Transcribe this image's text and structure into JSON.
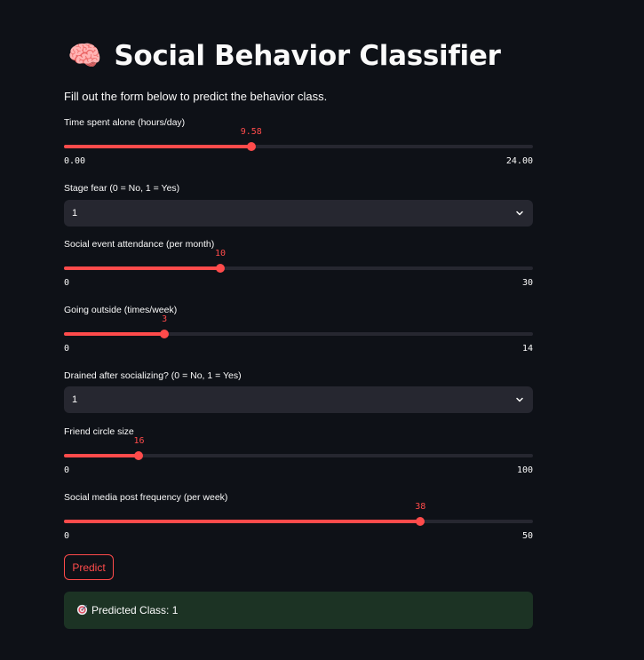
{
  "page": {
    "title_emoji": "🧠",
    "title": "Social Behavior Classifier",
    "subtitle": "Fill out the form below to predict the behavior class."
  },
  "fields": {
    "time_alone": {
      "label": "Time spent alone (hours/day)",
      "value_text": "9.58",
      "value": 9.58,
      "min_text": "0.00",
      "max_text": "24.00",
      "min": 0,
      "max": 24
    },
    "stage_fear": {
      "label": "Stage fear (0 = No, 1 = Yes)",
      "selected": "1"
    },
    "social_event": {
      "label": "Social event attendance (per month)",
      "value_text": "10",
      "value": 10,
      "min_text": "0",
      "max_text": "30",
      "min": 0,
      "max": 30
    },
    "going_outside": {
      "label": "Going outside (times/week)",
      "value_text": "3",
      "value": 3,
      "min_text": "0",
      "max_text": "14",
      "min": 0,
      "max": 14
    },
    "drained": {
      "label": "Drained after socializing? (0 = No, 1 = Yes)",
      "selected": "1"
    },
    "friend_circle": {
      "label": "Friend circle size",
      "value_text": "16",
      "value": 16,
      "min_text": "0",
      "max_text": "100",
      "min": 0,
      "max": 100
    },
    "post_frequency": {
      "label": "Social media post frequency (per week)",
      "value_text": "38",
      "value": 38,
      "min_text": "0",
      "max_text": "50",
      "min": 0,
      "max": 50
    }
  },
  "predict_button": "Predict",
  "result": {
    "icon": "target-icon",
    "text": "Predicted Class: 1"
  },
  "colors": {
    "background": "#0e1117",
    "accent": "#ff4b4b",
    "widget_bg": "#262730",
    "success_bg": "#1c3324"
  }
}
